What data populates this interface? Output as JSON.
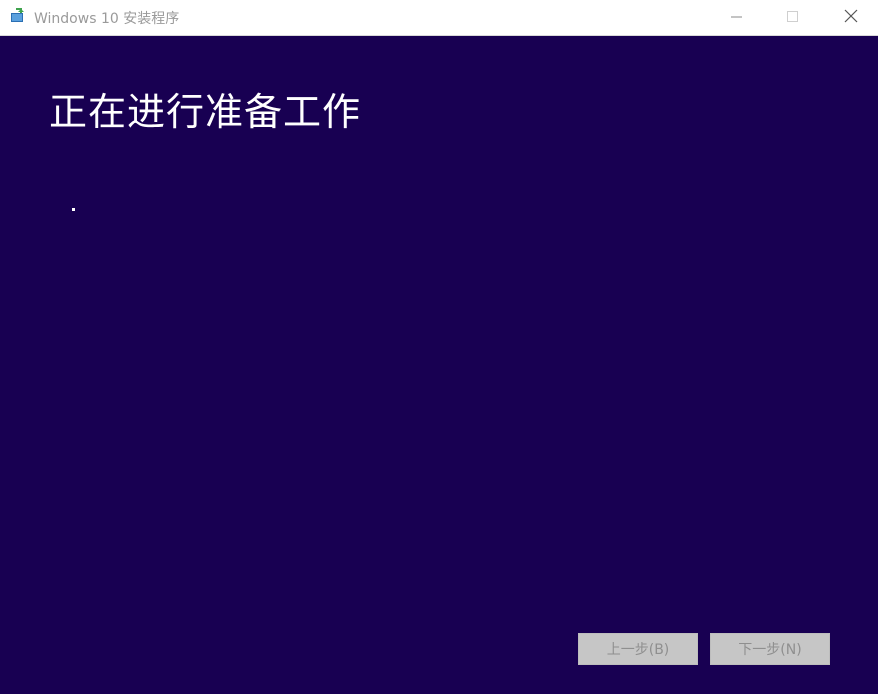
{
  "titlebar": {
    "title": "Windows 10 安装程序",
    "icon": "setup-icon",
    "minimize_icon": "minimize-icon",
    "maximize_icon": "maximize-icon",
    "close_icon": "close-icon"
  },
  "main": {
    "heading": "正在进行准备工作",
    "progress_indicator": "."
  },
  "footer": {
    "back_label": "上一步(B)",
    "next_label": "下一步(N)"
  },
  "colors": {
    "background": "#180052",
    "titlebar": "#ffffff",
    "button_disabled": "#c6c6c6",
    "text_disabled": "#8f8f8f"
  }
}
